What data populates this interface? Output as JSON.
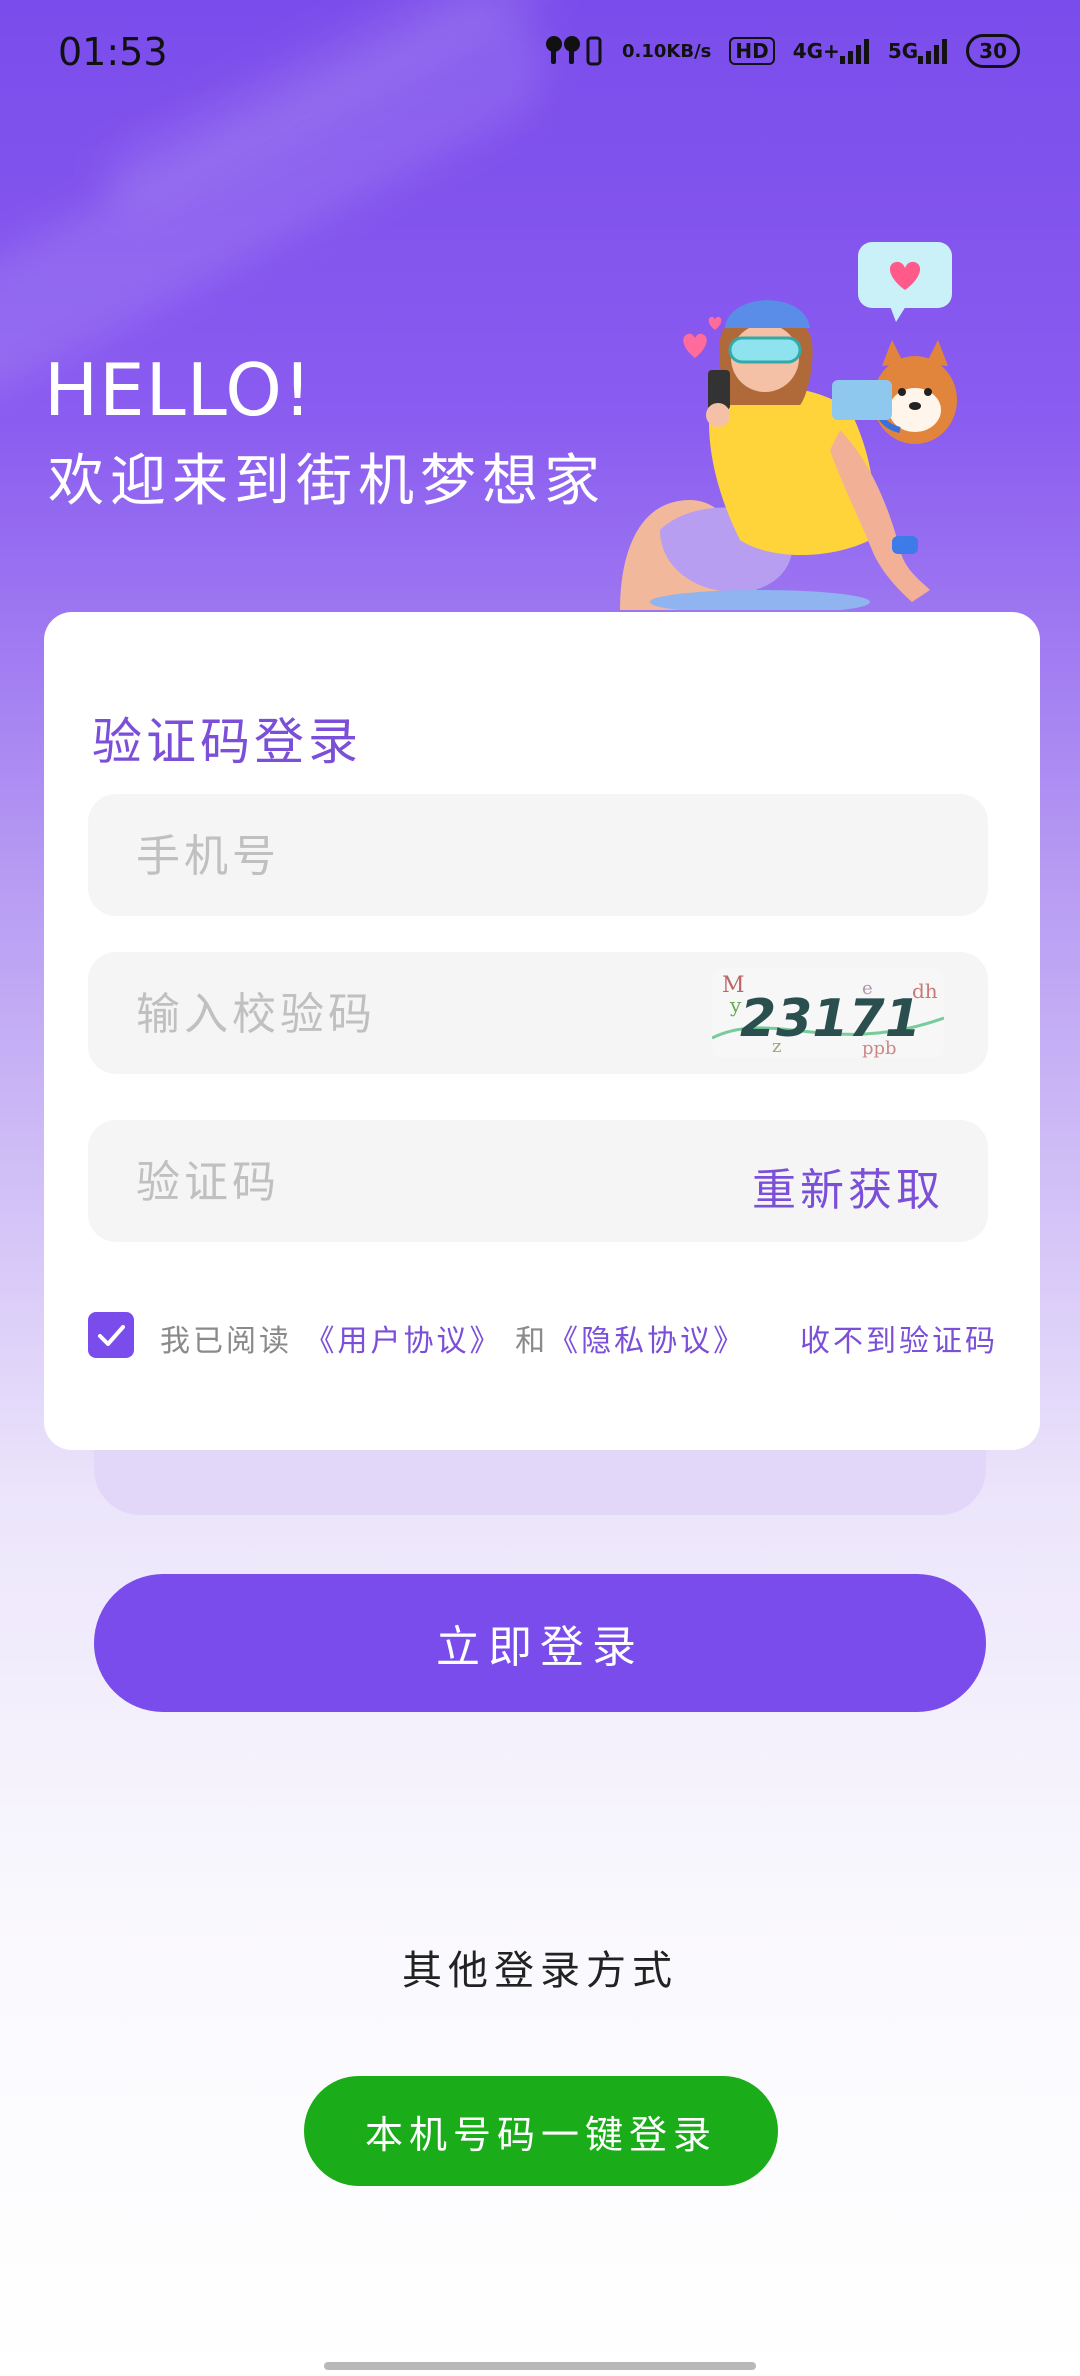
{
  "status_bar": {
    "time": "01:53",
    "net_speed_value": "0.10",
    "net_speed_unit": "KB/s",
    "hd_label": "HD",
    "sim1_label": "4G+",
    "sim2_label": "5G",
    "battery": "30",
    "icons": [
      "earbuds-icon",
      "hd-icon",
      "signal-4g-icon",
      "signal-5g-icon",
      "battery-icon"
    ]
  },
  "hero": {
    "hello": "HELLO!",
    "welcome": "欢迎来到街机梦想家"
  },
  "login_card": {
    "title": "验证码登录",
    "phone_placeholder": "手机号",
    "captcha_input_placeholder": "输入校验码",
    "captcha_image_text": "23171",
    "sms_code_placeholder": "验证码",
    "resend_label": "重新获取",
    "agree_prefix": "我已阅读",
    "user_agreement": "《用户协议》",
    "and_text": "和",
    "privacy_policy": "《隐私协议》",
    "no_code_label": "收不到验证码",
    "agree_checked": true
  },
  "actions": {
    "login_label": "立即登录",
    "other_methods_title": "其他登录方式",
    "one_key_login_label": "本机号码一键登录"
  },
  "colors": {
    "primary": "#7a4ceb",
    "accent_text": "#7b4fd8",
    "green": "#1aad19"
  }
}
